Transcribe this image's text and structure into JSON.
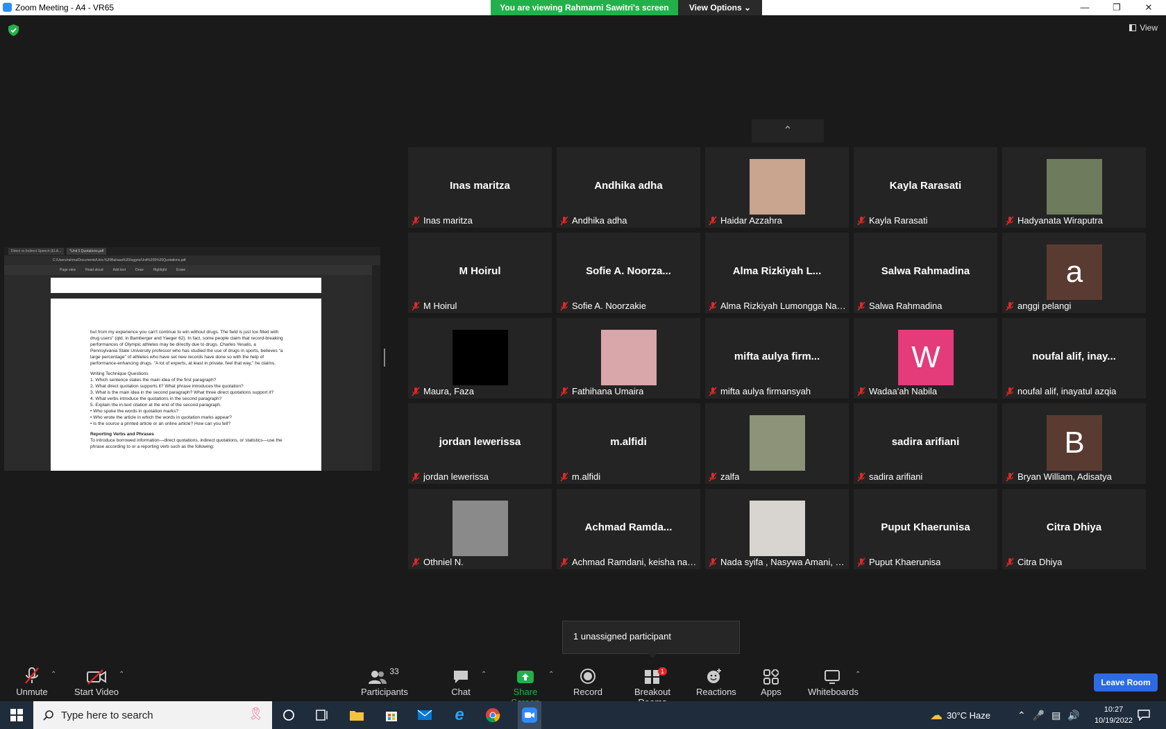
{
  "window": {
    "title": "Zoom Meeting - A4 - VR65",
    "banner": "You are viewing Rahmarni Sawitri's screen",
    "view_options": "View Options",
    "view_label": "View"
  },
  "shared_screen": {
    "tabs": [
      "Direct vs Indirect Speech (ELA...",
      "*Unit 5 Quotations.pdf"
    ],
    "address": "C:/Users/rahma/Documents/Univ.%20Bahasa%20Inggris/Unit%205%20Quotations.pdf",
    "tools": [
      "Page view",
      "Read aloud",
      "Add text",
      "Draw",
      "Highlight",
      "Erase"
    ],
    "paragraph": "but from my experience you can't continue to win without drugs. The field is just too filled with drug users\" (qtd. in Bamberger and Yaeger 62). In fact, some people claim that record-breaking performances of Olympic athletes may be directly due to drugs. Charles Yesalis, a Pennsylvania State University professor who has studied the use of drugs in sports, believes \"a large percentage\" of athletes who have set new records have done so with the help of performance-enhancing drugs. \"A lot of experts, at least in private, feel that way,\" he claims.",
    "questions_heading": "Writing Technique Questions",
    "questions": [
      "1.  Which sentence states the main idea of the first paragraph?",
      "2.  What direct quotation supports it? What phrase introduces the quotation?",
      "3.  What is the main idea in the second paragraph? What three direct quotations support it?",
      "4.  What verbs introduce the quotations in the second paragraph?",
      "5.  Explain the in-text citation at the end of the second paragraph.",
      "•  Who spoke the words in quotation marks?",
      "•  Who wrote the article in which the words in quotation marks appear?",
      "•  Is the source a printed article or an online article? How can you tell?"
    ],
    "section_heading": "Reporting Verbs and Phrases",
    "section_text": "To introduce borrowed information—direct quotations, indirect quotations, or statistics—use the phrase according to or a reporting verb such as the following:"
  },
  "participants": [
    {
      "display": "Inas maritza",
      "name": "Inas maritza",
      "kind": "name"
    },
    {
      "display": "Andhika adha",
      "name": "Andhika adha",
      "kind": "name"
    },
    {
      "display": "",
      "name": "Haidar Azzahra",
      "kind": "photo",
      "color": "#c9a48f"
    },
    {
      "display": "Kayla Rarasati",
      "name": "Kayla Rarasati",
      "kind": "name"
    },
    {
      "display": "",
      "name": "Hadyanata Wiraputra",
      "kind": "photo",
      "color": "#6e7b5c"
    },
    {
      "display": "M Hoirul",
      "name": "M Hoirul",
      "kind": "name"
    },
    {
      "display": "Sofie A. Noorza...",
      "name": "Sofie A. Noorzakie",
      "kind": "name"
    },
    {
      "display": "Alma Rizkiyah L...",
      "name": "Alma Rizkiyah Lumongga Nau...",
      "kind": "name"
    },
    {
      "display": "Salwa Rahmadina",
      "name": "Salwa Rahmadina",
      "kind": "name"
    },
    {
      "display": "a",
      "name": "anggi pelangi",
      "kind": "letter",
      "color": "#5a3b32"
    },
    {
      "display": "",
      "name": "Maura, Faza",
      "kind": "photo",
      "color": "#000000"
    },
    {
      "display": "",
      "name": "Fathihana Umaira",
      "kind": "photo",
      "color": "#d9a7a9"
    },
    {
      "display": "mifta aulya firm...",
      "name": "mifta aulya firmansyah",
      "kind": "name"
    },
    {
      "display": "W",
      "name": "Wadaa'ah Nabila",
      "kind": "letter",
      "color": "#e43b7b"
    },
    {
      "display": "noufal alif, inay...",
      "name": "noufal alif, inayatul azqia",
      "kind": "name"
    },
    {
      "display": "jordan lewerissa",
      "name": "jordan lewerissa",
      "kind": "name"
    },
    {
      "display": "m.alfidi",
      "name": "m.alfidi",
      "kind": "name"
    },
    {
      "display": "",
      "name": "zalfa",
      "kind": "photo",
      "color": "#8c9378"
    },
    {
      "display": "sadira arifiani",
      "name": "sadira arifiani",
      "kind": "name"
    },
    {
      "display": "B",
      "name": "Bryan William, Adisatya",
      "kind": "letter",
      "color": "#5a3b32"
    },
    {
      "display": "",
      "name": "Othniel N.",
      "kind": "photo",
      "color": "#8a8a8a"
    },
    {
      "display": "Achmad Ramda...",
      "name": "Achmad Ramdani, keisha nata...",
      "kind": "name"
    },
    {
      "display": "",
      "name": "Nada syifa , Nasywa Amani, S...",
      "kind": "photo",
      "color": "#d8d4d0"
    },
    {
      "display": "Puput Khaerunisa",
      "name": "Puput Khaerunisa",
      "kind": "name"
    },
    {
      "display": "Citra Dhiya",
      "name": "Citra Dhiya",
      "kind": "name"
    }
  ],
  "tooltip": "1 unassigned participant",
  "toolbar": {
    "unmute": "Unmute",
    "start_video": "Start Video",
    "participants": "Participants",
    "participant_count": "33",
    "chat": "Chat",
    "share_screen": "Share Screen",
    "record": "Record",
    "breakout_rooms": "Breakout Rooms",
    "breakout_badge": "1",
    "reactions": "Reactions",
    "apps": "Apps",
    "whiteboards": "Whiteboards",
    "leave_room": "Leave Room"
  },
  "taskbar": {
    "search_placeholder": "Type here to search",
    "weather": "30°C  Haze",
    "time": "10:27",
    "date": "10/19/2022"
  },
  "colors": {
    "banner_green": "#23b04b",
    "muted_red": "#e02828",
    "share_green": "#23b04b",
    "leave_blue": "#2d6ae3"
  }
}
